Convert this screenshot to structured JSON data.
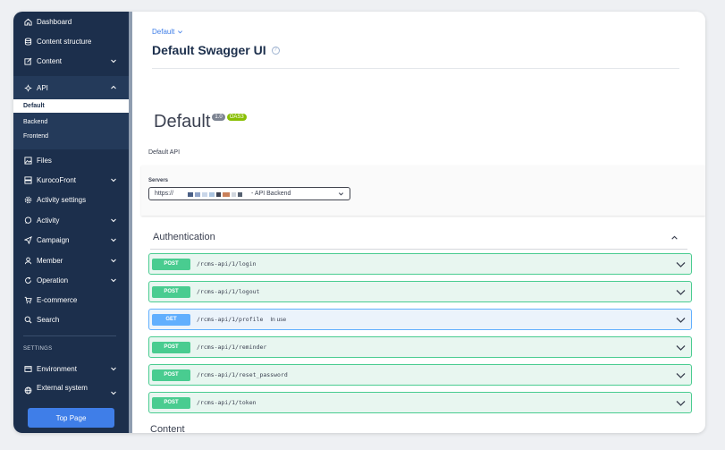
{
  "sidebar": {
    "items": [
      {
        "label": "Dashboard",
        "icon": "home-icon"
      },
      {
        "label": "Content structure",
        "icon": "database-icon"
      },
      {
        "label": "Content",
        "icon": "edit-icon",
        "chevron": "down"
      },
      {
        "label": "API",
        "icon": "api-icon",
        "chevron": "up"
      },
      {
        "label": "Files",
        "icon": "image-icon"
      },
      {
        "label": "KurocoFront",
        "icon": "server-icon",
        "chevron": "down"
      },
      {
        "label": "Activity settings",
        "icon": "gear-icon"
      },
      {
        "label": "Activity",
        "icon": "chat-icon",
        "chevron": "down"
      },
      {
        "label": "Campaign",
        "icon": "send-icon",
        "chevron": "down"
      },
      {
        "label": "Member",
        "icon": "user-icon",
        "chevron": "down"
      },
      {
        "label": "Operation",
        "icon": "refresh-icon",
        "chevron": "down"
      },
      {
        "label": "E-commerce",
        "icon": "cart-icon"
      },
      {
        "label": "Search",
        "icon": "search-icon"
      },
      {
        "label": "Environment",
        "icon": "window-icon",
        "chevron": "down"
      },
      {
        "label": "External system",
        "icon": "globe-icon",
        "chevron": "down"
      }
    ],
    "api_subitems": [
      {
        "label": "Default",
        "active": true
      },
      {
        "label": "Backend",
        "active": false
      },
      {
        "label": "Frontend",
        "active": false
      }
    ],
    "settings_section": "SETTINGS",
    "top_page_button": "Top Page"
  },
  "header": {
    "breadcrumb": "Default",
    "title": "Default Swagger UI"
  },
  "swagger": {
    "title": "Default",
    "version": "1.0",
    "oas": "OAS3",
    "description": "Default API",
    "servers_label": "Servers",
    "server_prefix": "https://",
    "server_suffix": "- API Backend",
    "tags": [
      {
        "name": "Authentication",
        "operations": [
          {
            "method": "POST",
            "path": "/rcms-api/1/login",
            "summary": ""
          },
          {
            "method": "POST",
            "path": "/rcms-api/1/logout",
            "summary": ""
          },
          {
            "method": "GET",
            "path": "/rcms-api/1/profile",
            "summary": "In use"
          },
          {
            "method": "POST",
            "path": "/rcms-api/1/reminder",
            "summary": ""
          },
          {
            "method": "POST",
            "path": "/rcms-api/1/reset_password",
            "summary": ""
          },
          {
            "method": "POST",
            "path": "/rcms-api/1/token",
            "summary": ""
          }
        ]
      },
      {
        "name": "Content"
      }
    ]
  },
  "colors": {
    "sidebar_bg": "#1c2f4c",
    "accent": "#3f7ee8",
    "post": "#49cc90",
    "get": "#61affe"
  }
}
